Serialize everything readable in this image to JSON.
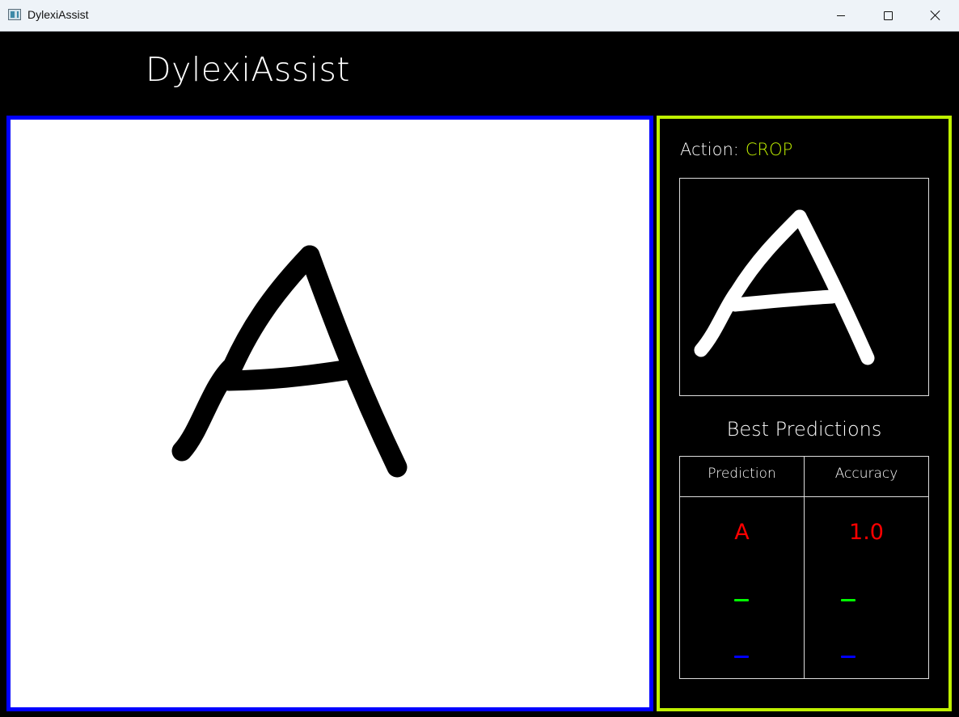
{
  "window": {
    "title": "DylexiAssist",
    "app_icon": "app-window-icon",
    "controls": {
      "minimize": "minimize-icon",
      "maximize": "maximize-icon",
      "close": "close-icon"
    }
  },
  "header": {
    "title": "DylexiAssist"
  },
  "canvas": {
    "border_color": "#0000ff",
    "background": "#ffffff",
    "stroke_color": "#000000",
    "drawn_letter": "A"
  },
  "side_panel": {
    "border_color": "#bff000",
    "action_label": "Action:",
    "action_value": "CROP",
    "action_value_color": "#c0f000",
    "crop_preview_letter": "A",
    "best_predictions_title": "Best Predictions",
    "table": {
      "headers": [
        "Prediction",
        "Accuracy"
      ],
      "rows": [
        {
          "prediction": "A",
          "accuracy": "1.0",
          "color": "#ff0000"
        },
        {
          "prediction": "-",
          "accuracy": "-",
          "color": "#00ff00"
        },
        {
          "prediction": "-",
          "accuracy": "-",
          "color": "#0000ff"
        }
      ]
    }
  }
}
